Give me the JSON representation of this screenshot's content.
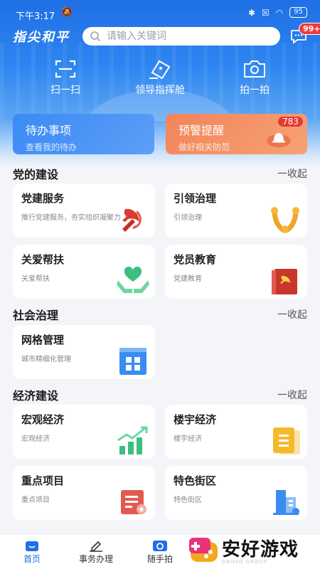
{
  "status": {
    "time": "下午3:17",
    "battery": "95"
  },
  "header": {
    "logo": "指尖和平",
    "search_placeholder": "请输入关键词",
    "msg_badge": "99+"
  },
  "quick": [
    {
      "label": "扫一扫",
      "icon": "scan-icon"
    },
    {
      "label": "领导指挥舱",
      "icon": "cockpit-icon"
    },
    {
      "label": "拍一拍",
      "icon": "camera-icon"
    }
  ],
  "tasks": {
    "todo": {
      "title": "待办事项",
      "subtitle": "查看我的待办"
    },
    "warn": {
      "title": "预警提醒",
      "subtitle": "做好相关防范",
      "badge": "783"
    }
  },
  "sections": [
    {
      "title": "党的建设",
      "collapse": "一收起",
      "items": [
        {
          "title": "党建服务",
          "subtitle": "推行党建服务，夯实组织凝聚力",
          "icon": "party-emblem-icon"
        },
        {
          "title": "引领治理",
          "subtitle": "引领治理",
          "icon": "leading-icon"
        },
        {
          "title": "关爱帮扶",
          "subtitle": "关爱帮扶",
          "icon": "care-icon"
        },
        {
          "title": "党员教育",
          "subtitle": "党建教育",
          "icon": "party-book-icon"
        }
      ]
    },
    {
      "title": "社会治理",
      "collapse": "一收起",
      "items": [
        {
          "title": "网格管理",
          "subtitle": "城市精细化管理",
          "icon": "grid-icon"
        }
      ]
    },
    {
      "title": "经济建设",
      "collapse": "一收起",
      "items": [
        {
          "title": "宏观经济",
          "subtitle": "宏观经济",
          "icon": "chart-icon"
        },
        {
          "title": "楼宇经济",
          "subtitle": "楼宇经济",
          "icon": "document-icon"
        },
        {
          "title": "重点项目",
          "subtitle": "重点项目",
          "icon": "project-icon"
        },
        {
          "title": "特色街区",
          "subtitle": "特色街区",
          "icon": "building-icon"
        }
      ]
    }
  ],
  "nav": [
    {
      "label": "首页",
      "icon": "home-icon"
    },
    {
      "label": "事务办理",
      "icon": "edit-icon"
    },
    {
      "label": "随手拍",
      "icon": "camera-icon"
    }
  ],
  "watermark": {
    "title": "安好游戏",
    "sub": "ANHAO GROUP"
  },
  "colors": {
    "primary": "#1f6fe6",
    "warn": "#f2845a",
    "badge": "#e53935"
  }
}
